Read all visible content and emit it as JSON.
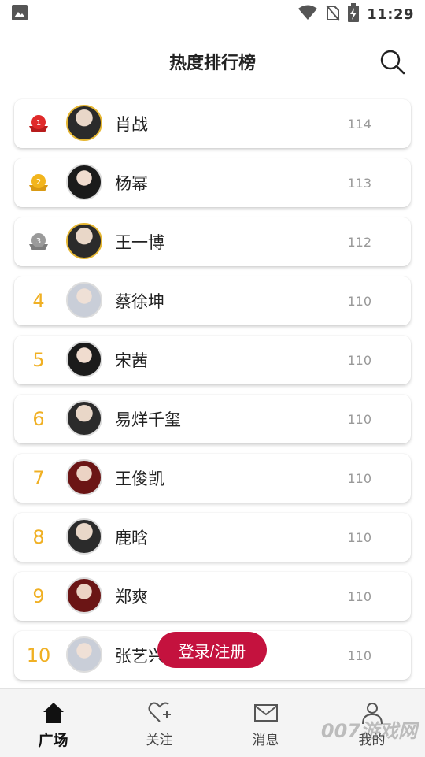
{
  "status_bar": {
    "time": "11:29"
  },
  "header": {
    "title": "热度排行榜"
  },
  "ranking": [
    {
      "rank": "1",
      "name": "肖战",
      "score": "114"
    },
    {
      "rank": "2",
      "name": "杨幂",
      "score": "113"
    },
    {
      "rank": "3",
      "name": "王一博",
      "score": "112"
    },
    {
      "rank": "4",
      "name": "蔡徐坤",
      "score": "110"
    },
    {
      "rank": "5",
      "name": "宋茜",
      "score": "110"
    },
    {
      "rank": "6",
      "name": "易烊千玺",
      "score": "110"
    },
    {
      "rank": "7",
      "name": "王俊凯",
      "score": "110"
    },
    {
      "rank": "8",
      "name": "鹿晗",
      "score": "110"
    },
    {
      "rank": "9",
      "name": "郑爽",
      "score": "110"
    },
    {
      "rank": "10",
      "name": "张艺兴",
      "score": "110"
    }
  ],
  "login_button": {
    "label": "登录/注册"
  },
  "tabs": [
    {
      "label": "广场",
      "icon": "home-icon"
    },
    {
      "label": "关注",
      "icon": "heart-plus-icon"
    },
    {
      "label": "消息",
      "icon": "mail-icon"
    },
    {
      "label": "我的",
      "icon": "person-icon"
    }
  ],
  "watermark": "007游戏网",
  "colors": {
    "accent": "#c4123e",
    "rank_text": "#f0b024",
    "medal_gold": "#f2b51d",
    "medal_red": "#e02a2a",
    "medal_silver": "#9a9a9a"
  }
}
